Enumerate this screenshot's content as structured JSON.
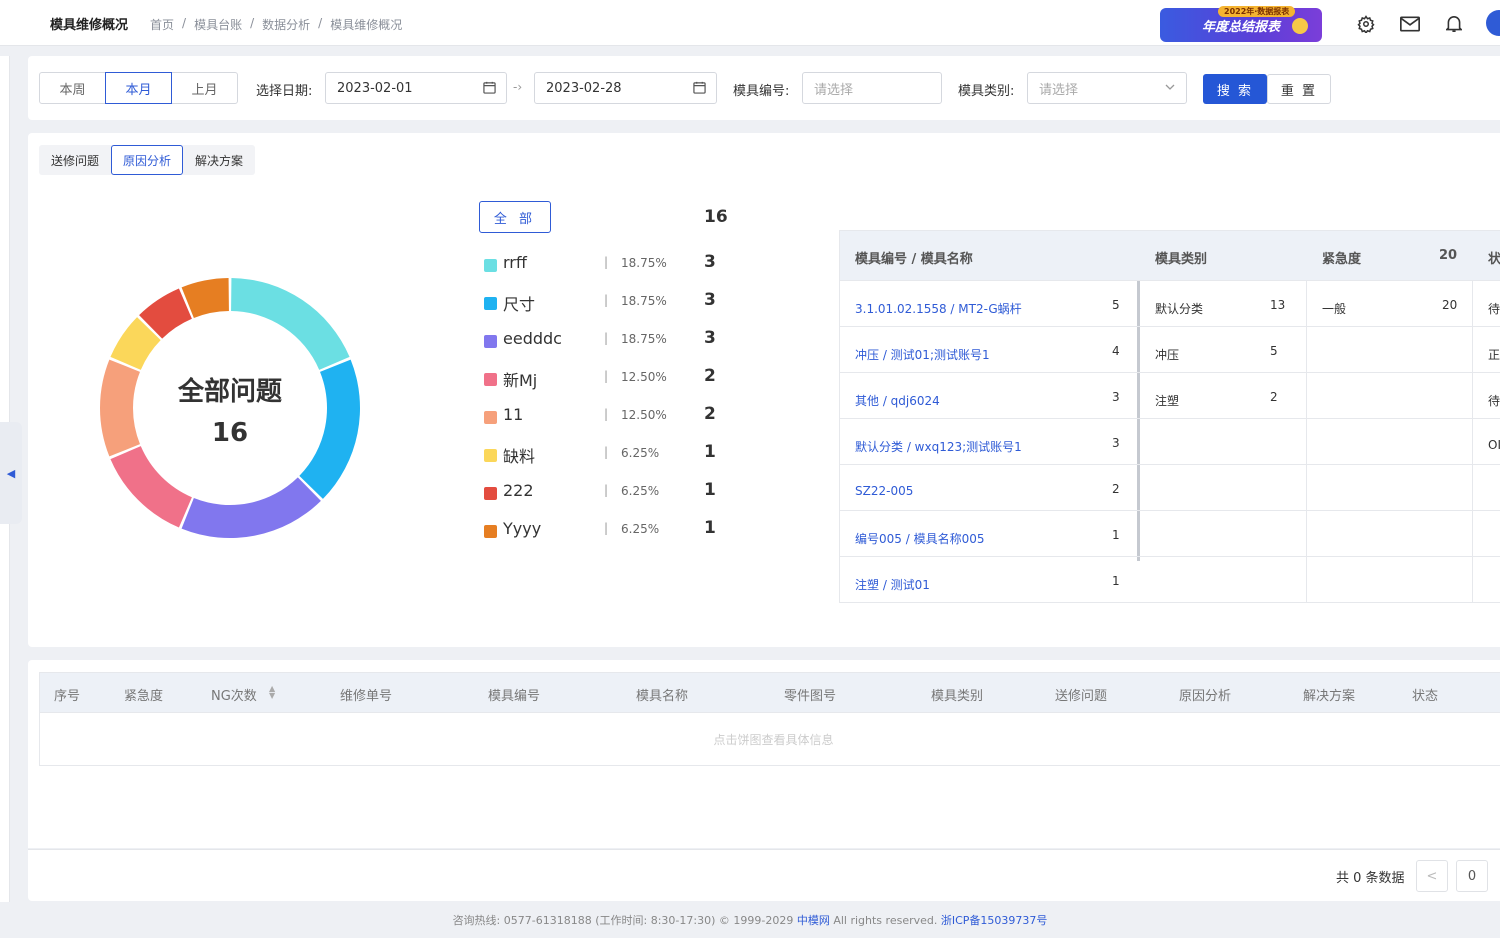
{
  "header": {
    "title": "模具维修概况",
    "breadcrumbs": [
      "首页",
      "模具台账",
      "数据分析",
      "模具维修概况"
    ],
    "banner_text": "年度总结报表",
    "banner_tag": "2022年·数据报表"
  },
  "filter": {
    "periods": [
      "本周",
      "本月",
      "上月"
    ],
    "active_period": "本月",
    "date_label": "选择日期:",
    "start_date": "2023-02-01",
    "end_date": "2023-02-28",
    "mold_no_label": "模具编号:",
    "mold_no_placeholder": "请选择",
    "mold_type_label": "模具类别:",
    "mold_type_placeholder": "请选择",
    "search_label": "搜 索",
    "reset_label": "重 置"
  },
  "tabs": [
    "送修问题",
    "原因分析",
    "解决方案"
  ],
  "active_tab": "原因分析",
  "chart_data": {
    "type": "pie",
    "center_title": "全部问题",
    "center_value": "16",
    "total_label": "全 部",
    "total": 16,
    "slices": [
      {
        "name": "rrff",
        "percent": "18.75%",
        "value": 3,
        "color": "#6bdfe3"
      },
      {
        "name": "尺寸",
        "percent": "18.75%",
        "value": 3,
        "color": "#1fb2f1"
      },
      {
        "name": "eedddc",
        "percent": "18.75%",
        "value": 3,
        "color": "#8177ee"
      },
      {
        "name": "新Mj",
        "percent": "12.50%",
        "value": 2,
        "color": "#f07189"
      },
      {
        "name": "11",
        "percent": "12.50%",
        "value": 2,
        "color": "#f6a07b"
      },
      {
        "name": "缺料",
        "percent": "6.25%",
        "value": 1,
        "color": "#fbd75a"
      },
      {
        "name": "222",
        "percent": "6.25%",
        "value": 1,
        "color": "#e34c3f"
      },
      {
        "name": "Yyyy",
        "percent": "6.25%",
        "value": 1,
        "color": "#e67e22"
      }
    ]
  },
  "right_table": {
    "headers": [
      "模具编号 / 模具名称",
      "模具类别",
      "紧急度",
      "20",
      "状"
    ],
    "col1": [
      {
        "name": "3.1.01.02.1558 / MT2-G蜗杆",
        "count": "5"
      },
      {
        "name": "冲压 / 测试01;测试账号1",
        "count": "4"
      },
      {
        "name": "其他 / qdj6024",
        "count": "3"
      },
      {
        "name": "默认分类 / wxq123;测试账号1",
        "count": "3"
      },
      {
        "name": "SZ22-005",
        "count": "2"
      },
      {
        "name": "编号005 / 模具名称005",
        "count": "1"
      },
      {
        "name": "注塑 / 测试01",
        "count": "1"
      }
    ],
    "col2": [
      {
        "name": "默认分类",
        "count": "13"
      },
      {
        "name": "冲压",
        "count": "5"
      },
      {
        "name": "注塑",
        "count": "2"
      }
    ],
    "col3": [
      {
        "name": "一般",
        "count": "20"
      }
    ],
    "col4": [
      "待",
      "正",
      "待",
      "OI"
    ]
  },
  "bottom_table": {
    "headers": [
      "序号",
      "紧急度",
      "NG次数",
      "维修单号",
      "模具编号",
      "模具名称",
      "零件图号",
      "模具类别",
      "送修问题",
      "原因分析",
      "解决方案",
      "状态"
    ],
    "empty_text": "点击饼图查看具体信息"
  },
  "pager": {
    "total_text": "共 0 条数据",
    "prev": "<",
    "page": "0"
  },
  "footer": {
    "text": "咨询热线: 0577-61318188 (工作时间: 8:30-17:30) © 1999-2029",
    "brand": "中模网",
    "rights": "All rights reserved.",
    "icp": "浙ICP备15039737号"
  }
}
